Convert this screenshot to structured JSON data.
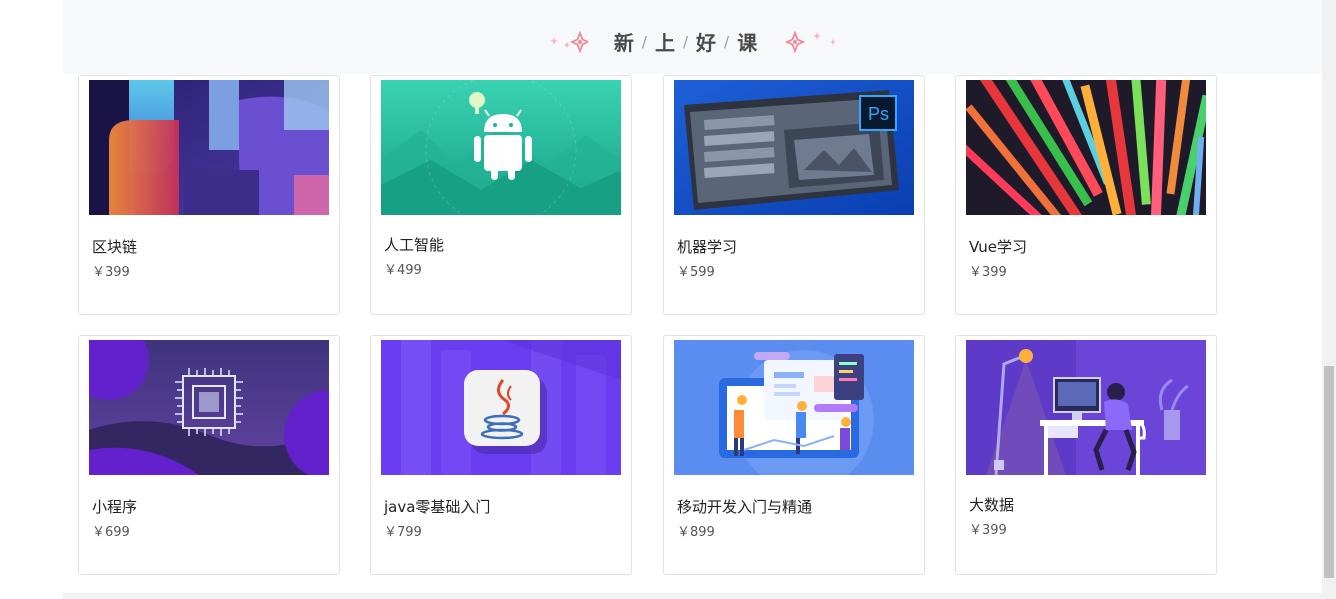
{
  "section": {
    "title_chars": [
      "新",
      "上",
      "好",
      "课"
    ],
    "separator": "/"
  },
  "courses": [
    {
      "name": "区块链",
      "price": "￥399",
      "thumb_icon": "abstract-3d-icon"
    },
    {
      "name": "人工智能",
      "price": "￥499",
      "thumb_icon": "android-icon"
    },
    {
      "name": "机器学习",
      "price": "￥599",
      "thumb_icon": "photoshop-icon"
    },
    {
      "name": "Vue学习",
      "price": "￥399",
      "thumb_icon": "color-bars-icon"
    },
    {
      "name": "小程序",
      "price": "￥699",
      "thumb_icon": "chip-icon"
    },
    {
      "name": "java零基础入门",
      "price": "￥799",
      "thumb_icon": "java-icon"
    },
    {
      "name": "移动开发入门与精通",
      "price": "￥899",
      "thumb_icon": "mobile-dev-icon"
    },
    {
      "name": "大数据",
      "price": "￥399",
      "thumb_icon": "desk-computer-icon"
    }
  ],
  "colors": {
    "header_band": "#f7f8fa",
    "title_text": "#4a4a4a",
    "sparkle": "#f08a9c",
    "card_border": "#e2e2e2"
  }
}
